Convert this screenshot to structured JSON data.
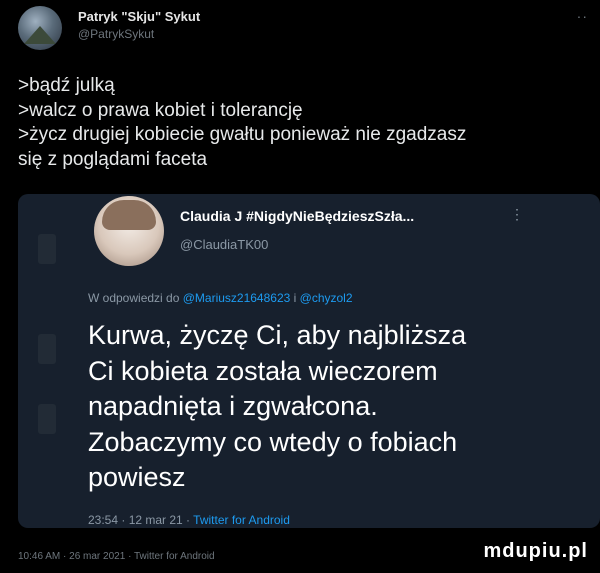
{
  "author": {
    "name": "Patryk \"Skju\" Sykut",
    "handle": "@PatrykSykut"
  },
  "tweet_lines": [
    ">bądź julką",
    ">walcz o prawa kobiet i tolerancję",
    ">życz drugiej kobiecie gwałtu ponieważ nie zgadzasz",
    "się z poglądami faceta"
  ],
  "quoted": {
    "name": "Claudia J #NigdyNieBędzieszSzła...",
    "handle": "@ClaudiaTK00",
    "reply_prefix": "W odpowiedzi do ",
    "reply_user1": "@Mariusz21648623",
    "reply_sep": " i ",
    "reply_user2": "@chyzol2",
    "body_lines": [
      "Kurwa, życzę Ci, aby najbliższa",
      "Ci kobieta została wieczorem",
      "napadnięta i zgwałcona.",
      "Zobaczymy co wtedy o fobiach",
      "powiesz"
    ],
    "meta_time": "23:54 · 12 mar 21 · ",
    "meta_source": "Twitter for Android"
  },
  "footer": "10:46 AM · 26 mar 2021 · Twitter for Android",
  "watermark": "mdupiu.pl",
  "colors": {
    "background": "#000000",
    "quote_card": "#17202d",
    "link": "#1d9bf0",
    "muted": "#6e767d"
  },
  "icons": [
    "avatar-image",
    "more-icon"
  ]
}
